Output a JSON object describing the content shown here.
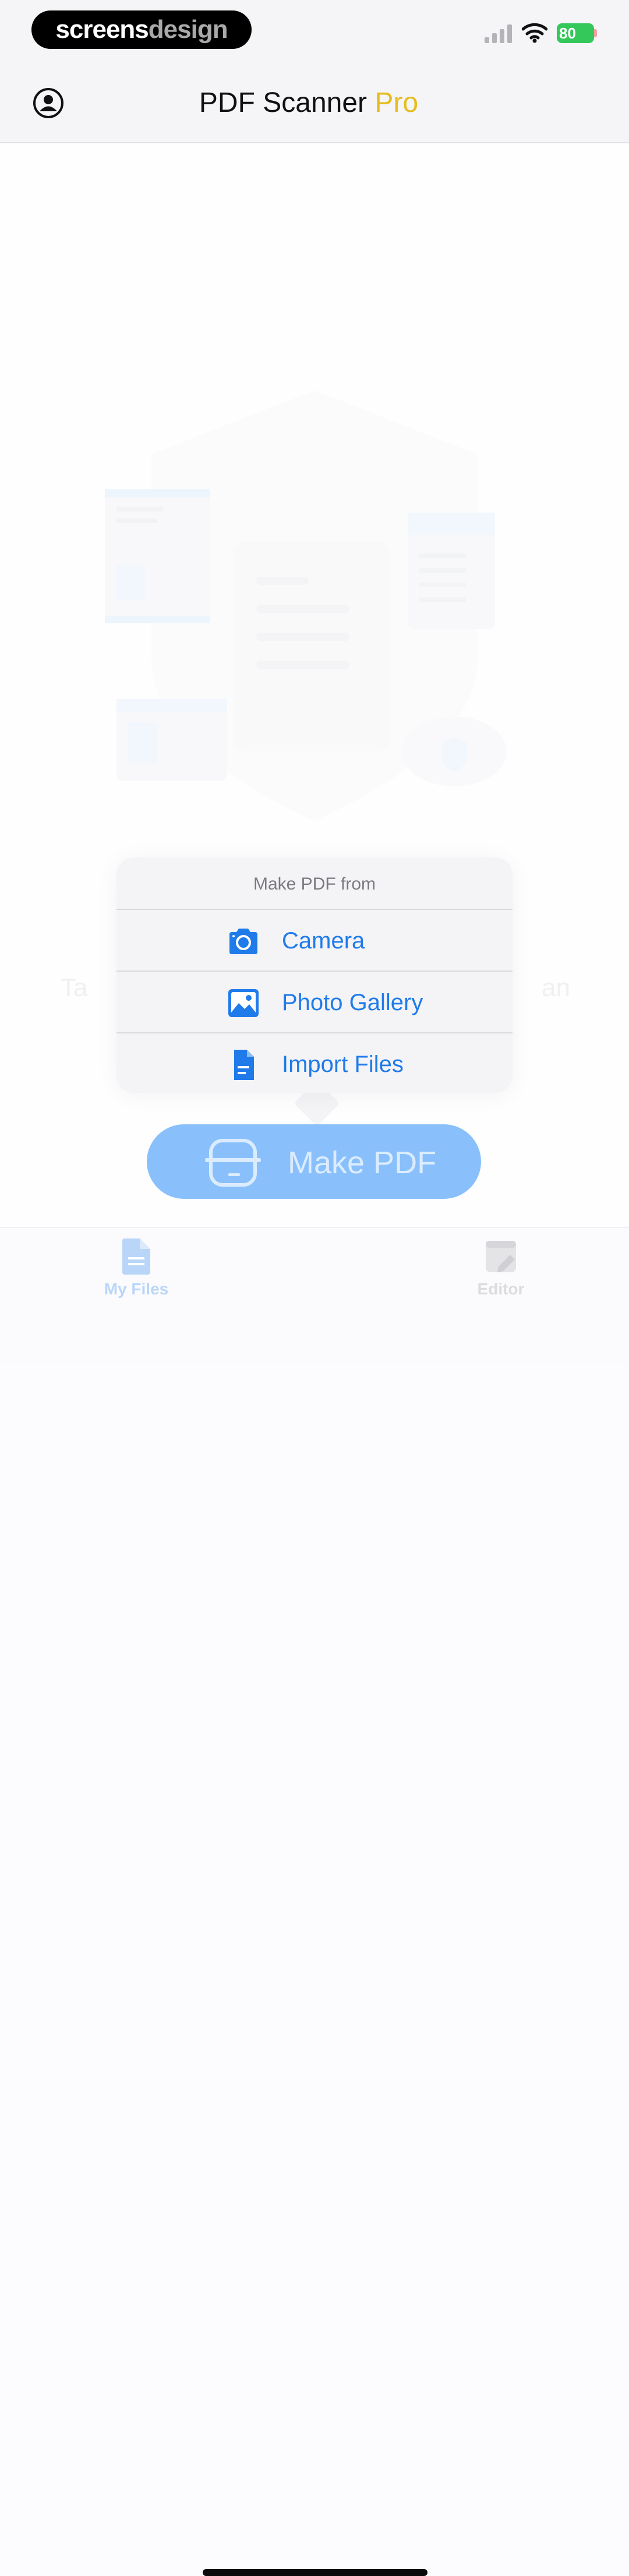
{
  "status_bar": {
    "brand_part1": "screens",
    "brand_part2": "design",
    "battery": "80"
  },
  "nav": {
    "title": "PDF Scanner",
    "title_accent": "Pro"
  },
  "background_text": {
    "left_fragment": "Ta",
    "right_fragment": "an"
  },
  "menu": {
    "header": "Make PDF from",
    "items": [
      {
        "label": "Camera",
        "icon": "camera-icon"
      },
      {
        "label": "Photo Gallery",
        "icon": "photo-icon"
      },
      {
        "label": "Import Files",
        "icon": "document-icon"
      }
    ]
  },
  "make_pdf_button": {
    "label": "Make PDF",
    "icon": "scanner-icon"
  },
  "tabs": [
    {
      "label": "My Files",
      "icon": "file-icon",
      "selected": true
    },
    {
      "label": "Editor",
      "icon": "editor-icon",
      "selected": false
    }
  ],
  "colors": {
    "accent_blue": "#1f7bea",
    "pro_yellow": "#e6bd1e",
    "button_blue": "#89c0fb",
    "battery_green": "#34c759"
  }
}
